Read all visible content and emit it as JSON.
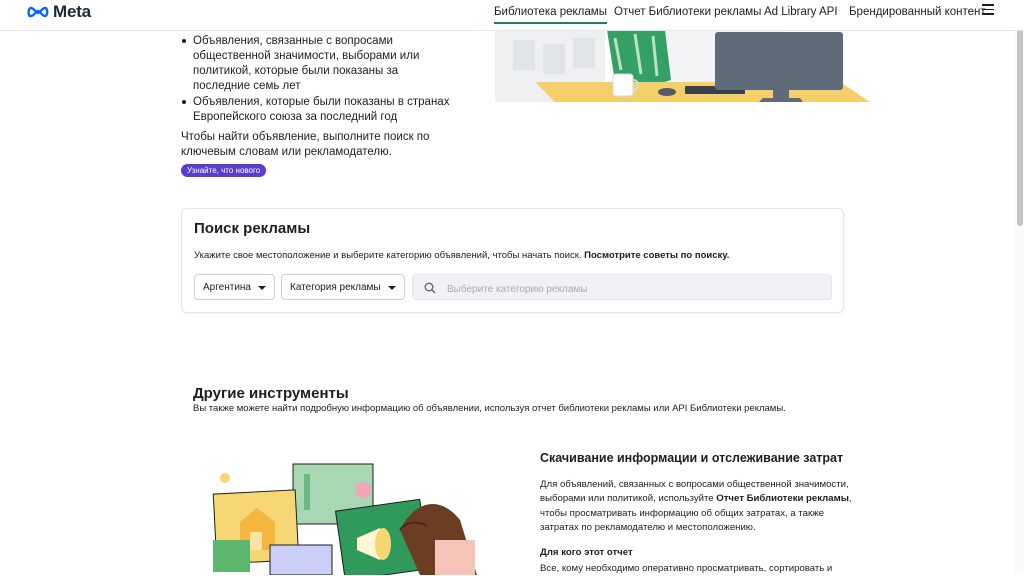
{
  "brand": {
    "name": "Meta"
  },
  "nav": {
    "items": [
      {
        "label": "Библиотека рекламы",
        "active": true
      },
      {
        "label": "Отчет Библиотеки рекламы",
        "active": false
      },
      {
        "label": "Ad Library API",
        "active": false
      },
      {
        "label": "Брендированный контент",
        "active": false
      }
    ],
    "menu_icon": "hamburger-menu-icon"
  },
  "intro": {
    "bullets": [
      "Объявления, связанные с вопросами общественной значимости, выборами или политикой, которые были показаны за последние семь лет",
      "Объявления, которые были показаны в странах Европейского союза за последний год"
    ],
    "search_prompt": "Чтобы найти объявление, выполните поиск по ключевым словам или рекламодателю.",
    "whats_new_label": "Узнайте, что нового"
  },
  "search": {
    "title": "Поиск рекламы",
    "hint": "Укажите свое местоположение и выберите категорию объявлений, чтобы начать поиск.",
    "hint_link": "Посмотрите советы по поиску.",
    "country": "Аргентина",
    "category": "Категория рекламы",
    "placeholder": "Выберите категорию рекламы",
    "value": ""
  },
  "other_tools": {
    "title": "Другие инструменты",
    "subtitle": "Вы также можете найти подробную информацию об объявлении, используя отчет библиотеки рекламы или API Библиотеки рекламы."
  },
  "download": {
    "title": "Скачивание информации и отслеживание затрат",
    "text_before": "Для объявлений, связанных с вопросами общественной значимости, выборами или политикой, используйте ",
    "text_bold": "Отчет Библиотеки рекламы",
    "text_after": ", чтобы просматривать информацию об общих затратах, а также затратах по рекламодателю и местоположению.",
    "who_title": "Для кого этот отчет",
    "who_text": "Все, кому необходимо оперативно просматривать, сортировать и"
  },
  "colors": {
    "active_tab": "#1b7f6b",
    "pill": "#5b3ccf",
    "text": "#1c1e21",
    "border": "#e4e6eb"
  }
}
